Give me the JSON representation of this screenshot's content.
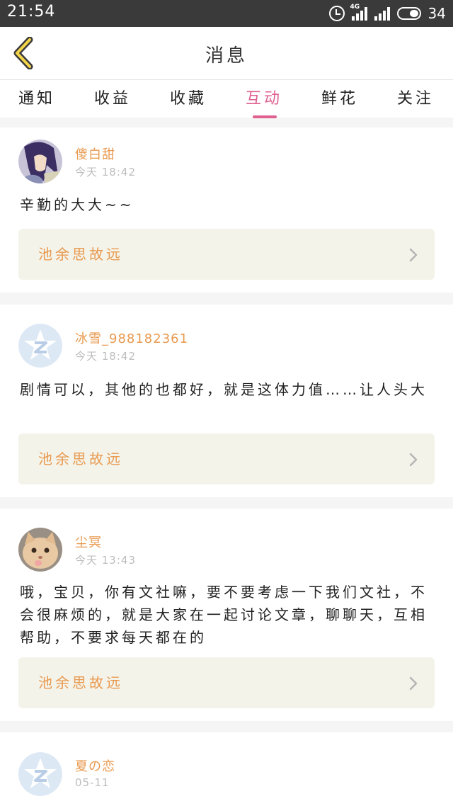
{
  "status_bar": {
    "time": "21:54",
    "network": "4G",
    "battery": "34"
  },
  "header": {
    "title": "消息"
  },
  "tabs": [
    "通知",
    "收益",
    "收藏",
    "互动",
    "鲜花",
    "关注"
  ],
  "active_tab": "互动",
  "colors": {
    "accent_pink": "#e06090",
    "name_orange": "#e89a50",
    "ref_bg": "#f4f3ea"
  },
  "messages": [
    {
      "user": "傻白甜",
      "time": "今天 18:42",
      "text": "辛勤的大大~~",
      "ref_title": "池余思故远",
      "avatar": "anime-avatar"
    },
    {
      "user": "冰雪_988182361",
      "time": "今天 18:42",
      "text": "剧情可以，其他的也都好，就是这体力值……让人头大",
      "ref_title": "池余思故远",
      "avatar": "default-q-avatar"
    },
    {
      "user": "尘冥",
      "time": "今天 13:43",
      "text": "哦，宝贝，你有文社嘛，要不要考虑一下我们文社，不会很麻烦的，就是大家在一起讨论文章，聊聊天，互相帮助，不要求每天都在的",
      "ref_title": "池余思故远",
      "avatar": "cat-avatar"
    },
    {
      "user": "夏の恋",
      "time": "05-11",
      "avatar": "default-q-avatar"
    }
  ]
}
